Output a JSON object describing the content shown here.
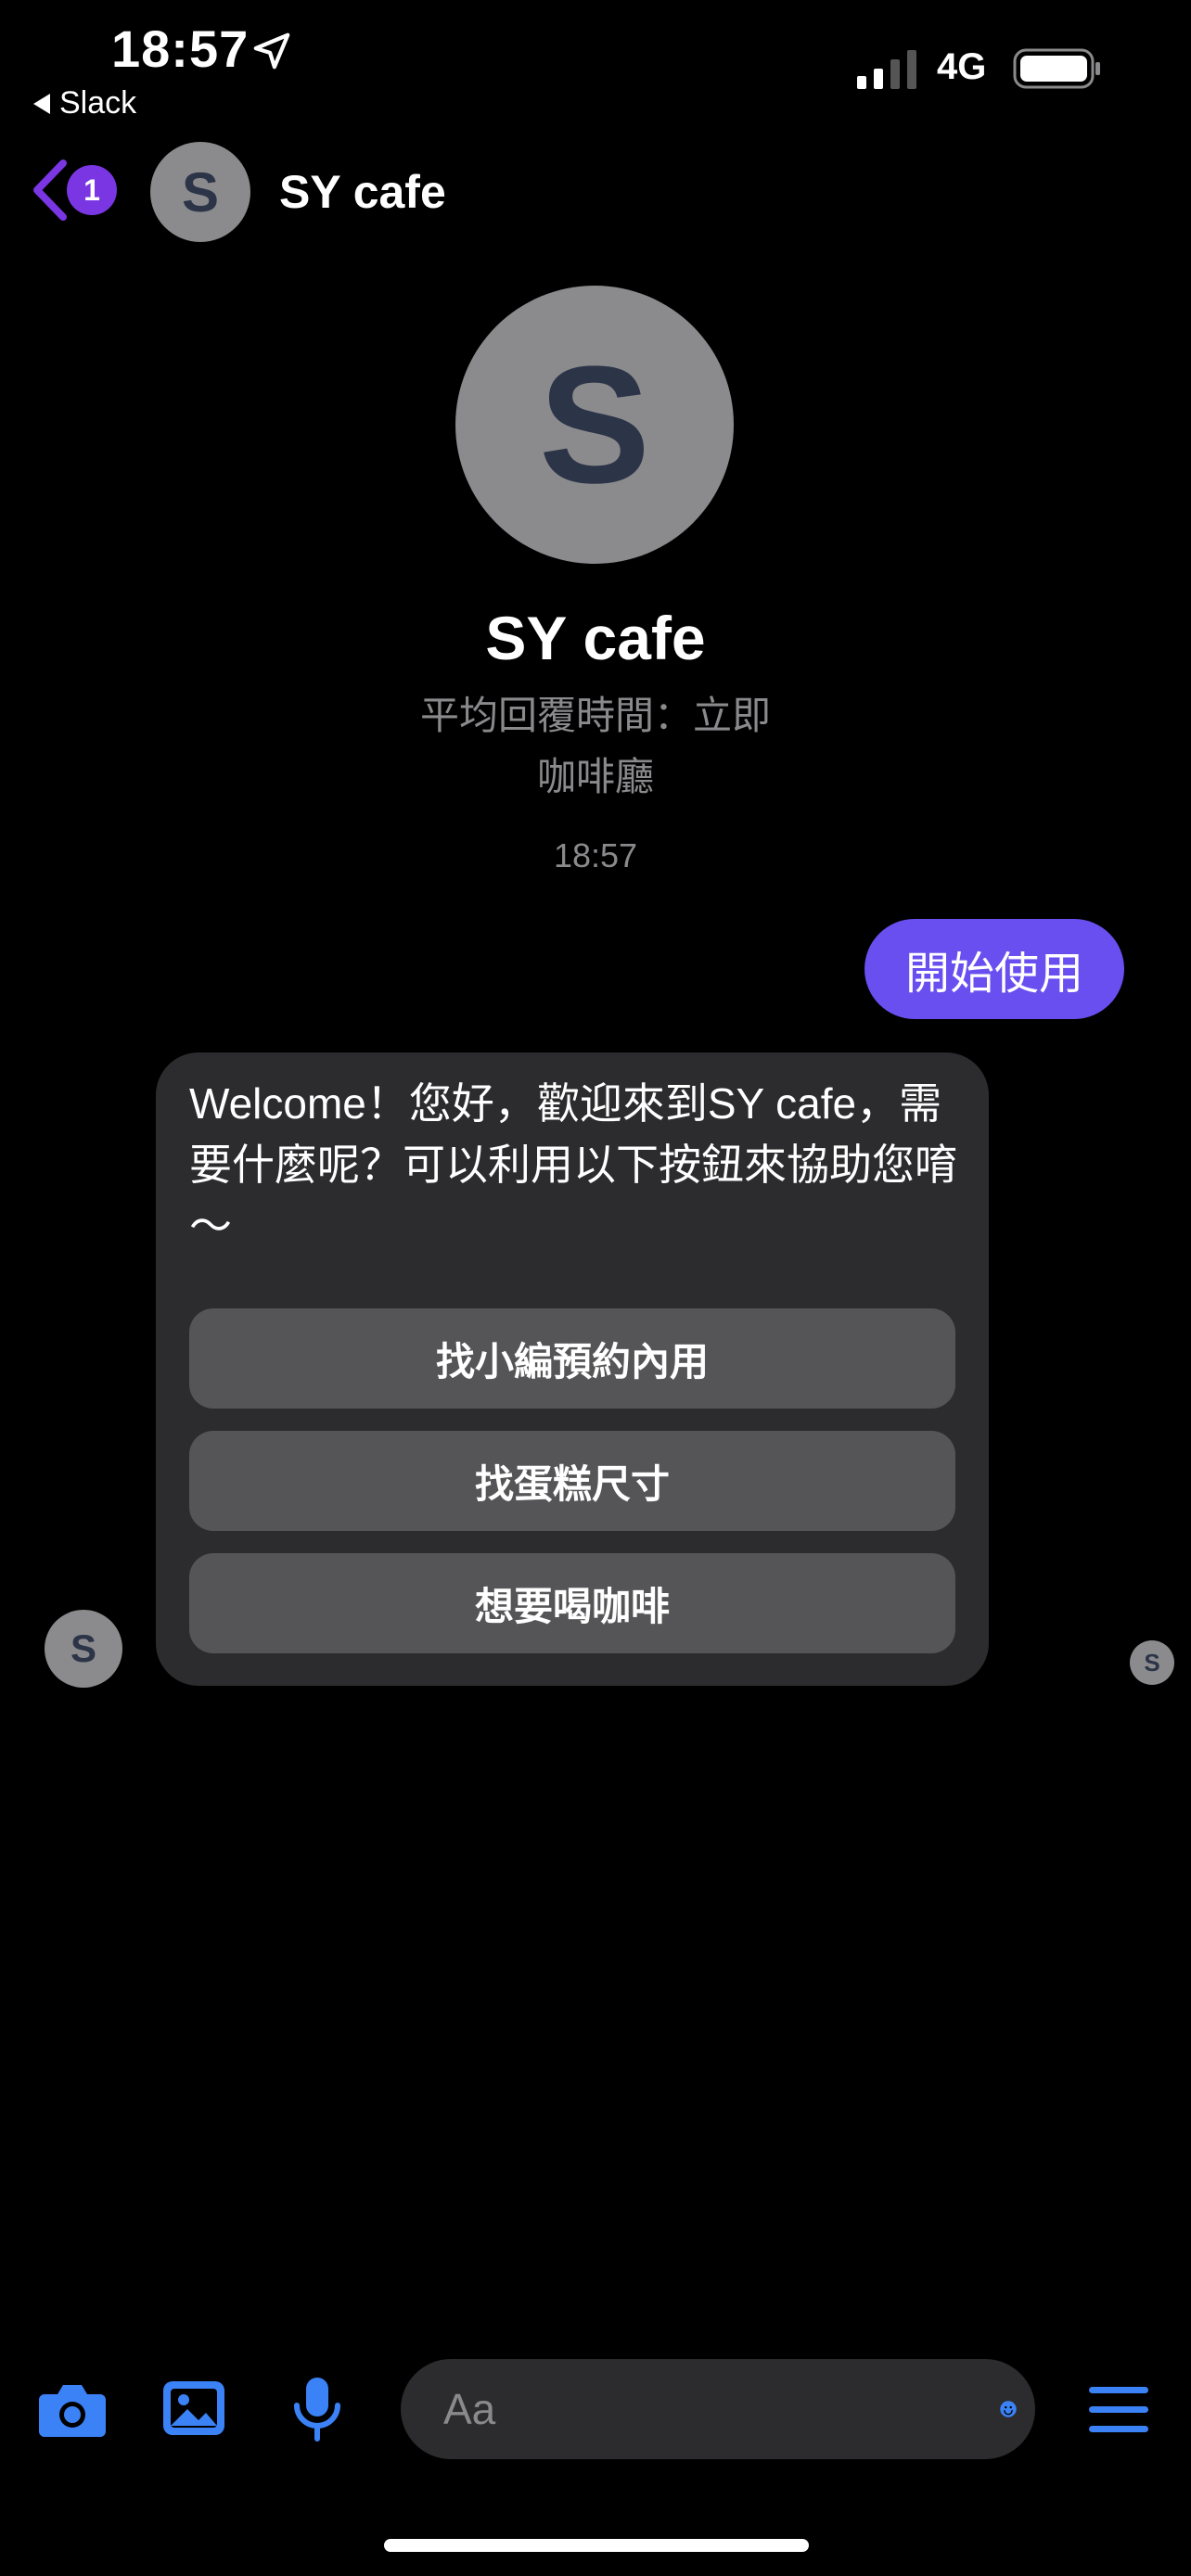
{
  "status_bar": {
    "time": "18:57",
    "back_app": "Slack",
    "network": "4G"
  },
  "header": {
    "back_badge": "1",
    "avatar_letter": "S",
    "title": "SY cafe"
  },
  "profile": {
    "avatar_letter": "S",
    "name": "SY cafe",
    "response_time": "平均回覆時間：立即",
    "category": "咖啡廳"
  },
  "conversation": {
    "timestamp": "18:57",
    "outgoing_message": "開始使用",
    "bot_message": "Welcome！您好，歡迎來到SY cafe，需要什麼呢？可以利用以下按鈕來協助您唷～",
    "quick_replies": [
      {
        "label": "找小編預約內用"
      },
      {
        "label": "找蛋糕尺寸"
      },
      {
        "label": "想要喝咖啡"
      }
    ],
    "sender_avatar_letter": "S",
    "read_receipt_letter": "S"
  },
  "composer": {
    "placeholder": "Aa"
  },
  "icons": [
    "location-arrow-icon",
    "signal-icon",
    "battery-icon",
    "chevron-left-icon",
    "camera-icon",
    "image-icon",
    "microphone-icon",
    "emoji-icon",
    "menu-icon"
  ],
  "colors": {
    "accent": "#6a4ff0",
    "badge": "#7a36e3",
    "icon_blue": "#3b82f6",
    "bubble_gray": "#2c2c2e"
  }
}
